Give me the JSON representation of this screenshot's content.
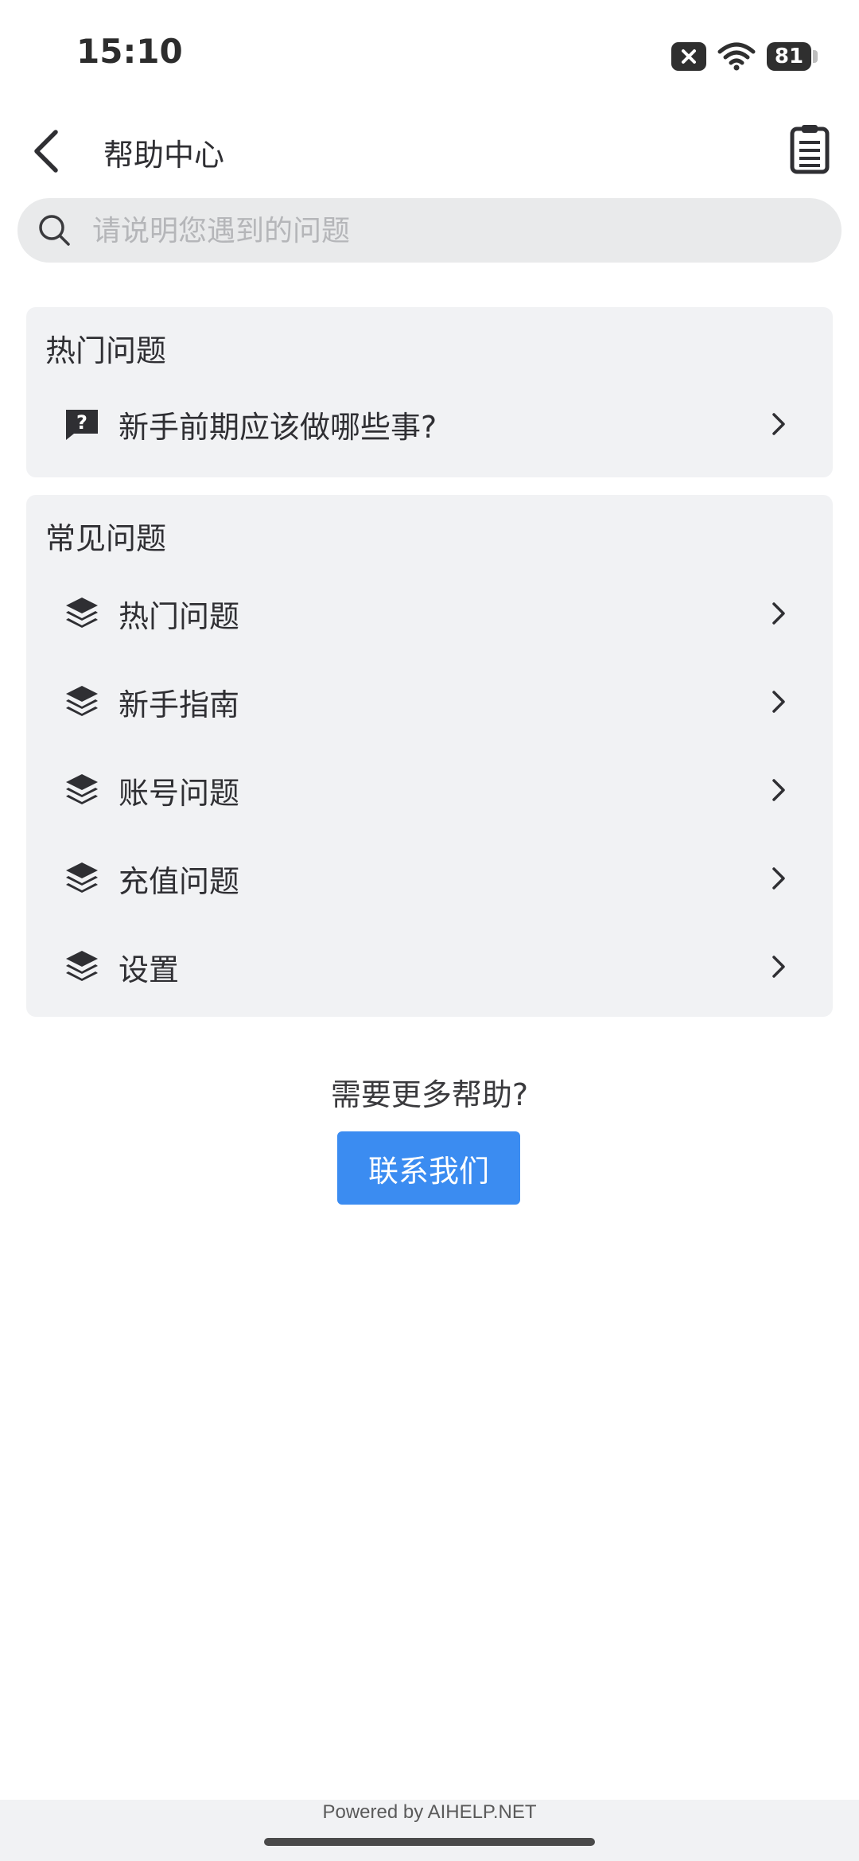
{
  "status_bar": {
    "time": "15:10",
    "battery": "81"
  },
  "header": {
    "title": "帮助中心"
  },
  "search": {
    "placeholder": "请说明您遇到的问题"
  },
  "hot_section": {
    "title": "热门问题",
    "items": [
      {
        "label": "新手前期应该做哪些事?"
      }
    ]
  },
  "faq_section": {
    "title": "常见问题",
    "items": [
      {
        "label": "热门问题"
      },
      {
        "label": "新手指南"
      },
      {
        "label": "账号问题"
      },
      {
        "label": "充值问题"
      },
      {
        "label": "设置"
      }
    ]
  },
  "help": {
    "prompt": "需要更多帮助?",
    "contact_label": "联系我们"
  },
  "footer": {
    "powered_by": "Powered by AIHELP.NET"
  },
  "colors": {
    "accent": "#3b8cf1",
    "card_bg": "#f1f2f4",
    "search_bg": "#e9eaeb"
  }
}
